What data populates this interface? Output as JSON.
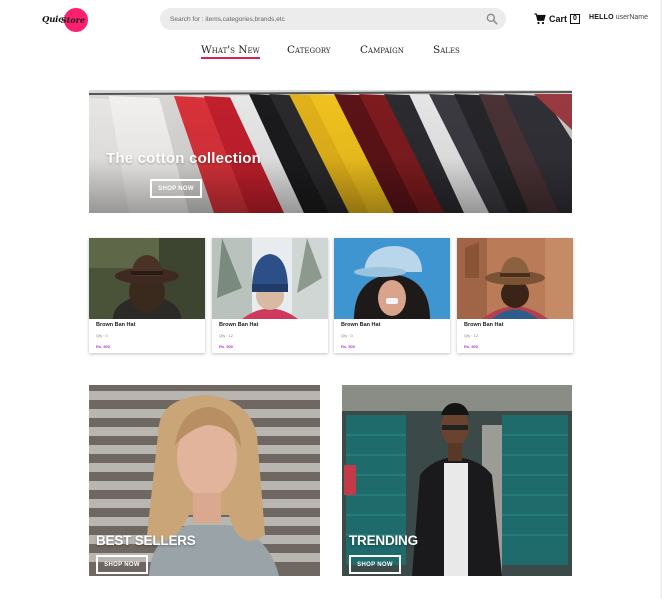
{
  "header": {
    "logo": {
      "word1": "Quick",
      "word2": "Store",
      "brand_color": "#ff1f70"
    },
    "search": {
      "placeholder": "Search for : items,categories,brands,etc",
      "icon": "search-icon"
    },
    "cart": {
      "label": "Cart",
      "count": "0",
      "icon": "cart-icon"
    },
    "greeting": {
      "hello": "HELLO",
      "user": "userName"
    }
  },
  "nav": {
    "accent_color": "#d6224e",
    "items": [
      {
        "label": "What's New",
        "active": true
      },
      {
        "label": "Category",
        "active": false
      },
      {
        "label": "Campaign",
        "active": false
      },
      {
        "label": "Sales",
        "active": false
      }
    ]
  },
  "hero": {
    "title": "The cotton collection",
    "button": "SHOP NOW"
  },
  "products": [
    {
      "name": "Brown Ban Hat",
      "qty": "Qty : 0",
      "price": "Rs. 500"
    },
    {
      "name": "Brown Ban Hat",
      "qty": "Qty : 12",
      "price": "Rs. 500"
    },
    {
      "name": "Brown Ban Hat",
      "qty": "Qty : 0",
      "price": "Rs. 500"
    },
    {
      "name": "Brown Ban Hat",
      "qty": "Qty : 12",
      "price": "Rs. 500"
    }
  ],
  "price_color": "#b03ad6",
  "promos": [
    {
      "title": "BEST SELLERS",
      "button": "SHOP NOW"
    },
    {
      "title": "TRENDING",
      "button": "SHOP NOW"
    }
  ]
}
